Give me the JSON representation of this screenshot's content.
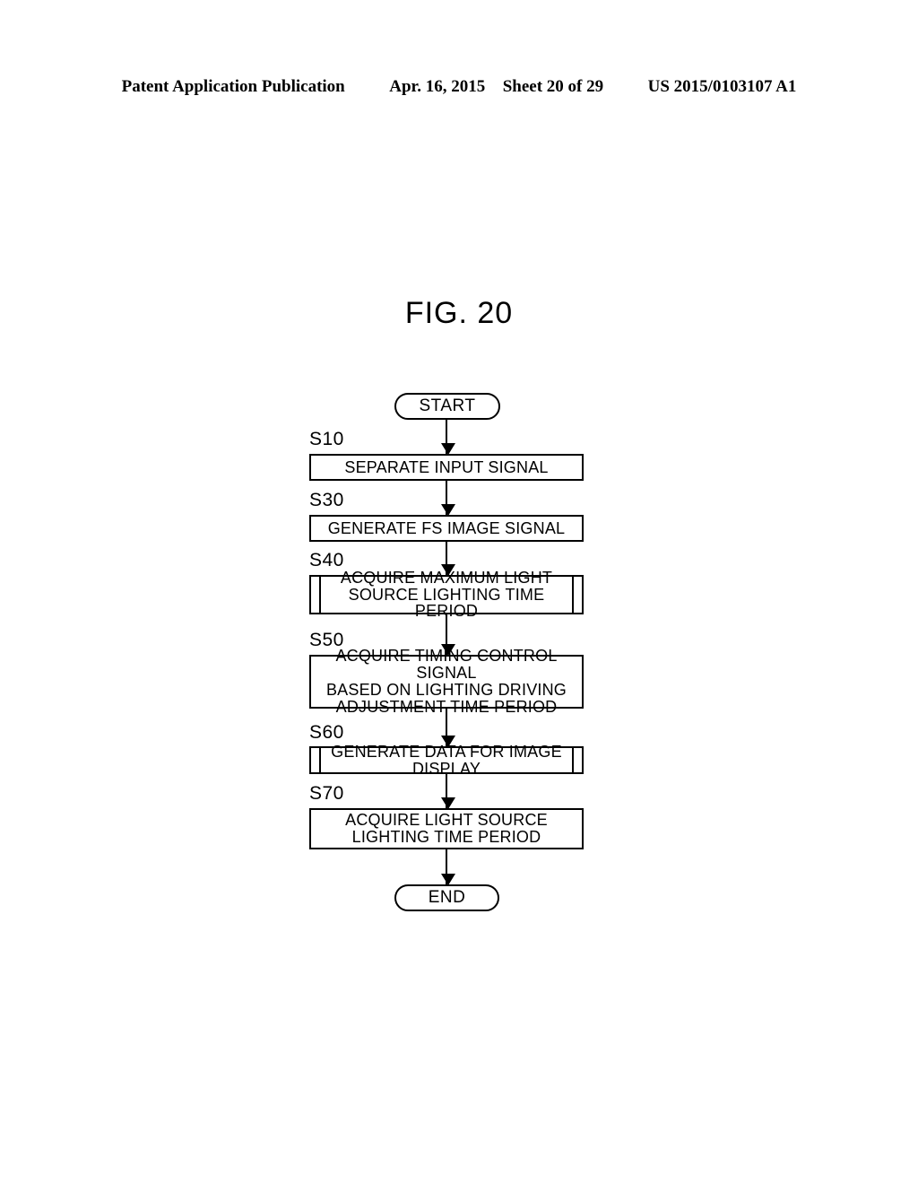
{
  "header": {
    "publication": "Patent Application Publication",
    "date": "Apr. 16, 2015",
    "sheet": "Sheet 20 of 29",
    "patent_number": "US 2015/0103107 A1"
  },
  "figure": {
    "title": "FIG. 20"
  },
  "flowchart": {
    "start_label": "START",
    "end_label": "END",
    "steps": [
      {
        "id": "S10",
        "text": "SEPARATE INPUT SIGNAL",
        "shape": "process"
      },
      {
        "id": "S30",
        "text": "GENERATE FS IMAGE SIGNAL",
        "shape": "process"
      },
      {
        "id": "S40",
        "line1": "ACQUIRE MAXIMUM LIGHT",
        "line2": "SOURCE LIGHTING TIME PERIOD",
        "shape": "predefined-process"
      },
      {
        "id": "S50",
        "line1": "ACQUIRE TIMING CONTROL SIGNAL",
        "line2": "BASED ON LIGHTING DRIVING",
        "line3": "ADJUSTMENT TIME PERIOD",
        "shape": "process"
      },
      {
        "id": "S60",
        "text": "GENERATE DATA FOR IMAGE DISPLAY",
        "shape": "predefined-process"
      },
      {
        "id": "S70",
        "line1": "ACQUIRE LIGHT SOURCE",
        "line2": "LIGHTING TIME PERIOD",
        "shape": "process"
      }
    ]
  },
  "colors": {
    "ink": "#000000",
    "paper": "#ffffff"
  }
}
